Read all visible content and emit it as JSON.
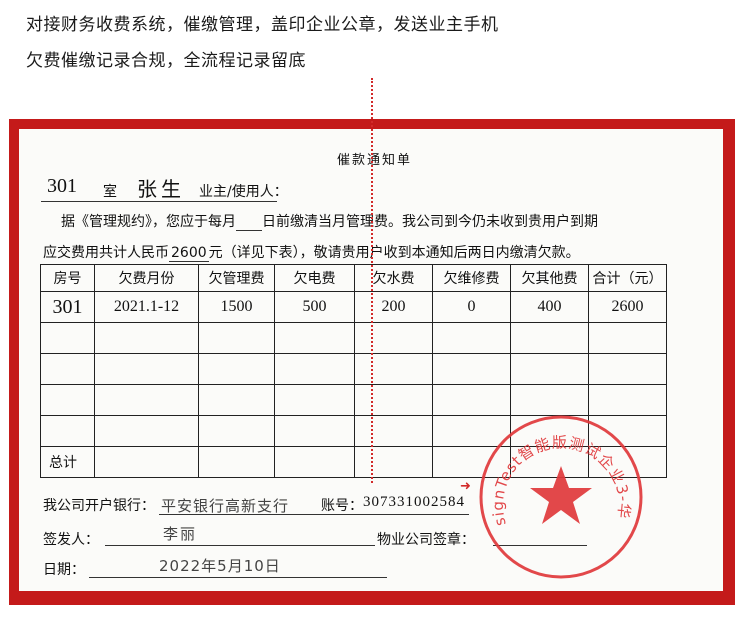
{
  "caption": {
    "line1": "对接财务收费系统，催缴管理，盖印企业公章，发送业主手机",
    "line2": "欠费催缴记录合规，全流程记录留底"
  },
  "notice": {
    "title": "催款通知单",
    "room_no": "301",
    "room_unit": "室",
    "tenant_name": "张生",
    "tenant_label": "业主/使用人：",
    "body_line1_pre": "据《管理规约》，您应于每月",
    "body_line1_post": "日前缴清当月管理费。我公司到今仍未收到贵用户到期",
    "body_line2_pre": "应交费用共计人民币",
    "amount": "2600",
    "body_line2_post": "元（详见下表），敬请贵用户收到本通知后两日内缴清欠款。"
  },
  "table": {
    "headers": [
      "房号",
      "欠费月份",
      "欠管理费",
      "欠电费",
      "欠水费",
      "欠维修费",
      "欠其他费",
      "合计（元）"
    ],
    "rows": [
      [
        "301",
        "2021.1-12",
        "1500",
        "500",
        "200",
        "0",
        "400",
        "2600"
      ]
    ],
    "total_label": "总计"
  },
  "footer": {
    "bank_label": "我公司开户银行：",
    "bank_name": "平安银行高新支行",
    "account_label": "账号：",
    "account_no": "307331002584",
    "issuer_label": "签发人：",
    "issuer_name": "李丽",
    "company_seal_label": "物业公司签章：",
    "date_label": "日期：",
    "date_value": "2022年5月10日"
  },
  "stamp": {
    "text": "esignTest智能版测试企业3-华东",
    "color": "#e0393c"
  },
  "colors": {
    "frame": "#c41a1a",
    "dotted_line": "#d22a2a"
  }
}
